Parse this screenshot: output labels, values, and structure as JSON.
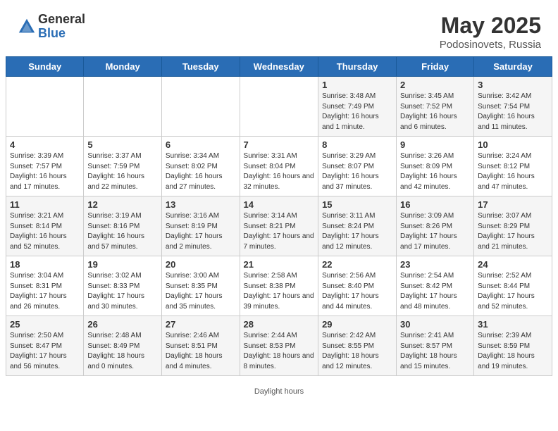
{
  "header": {
    "logo_general": "General",
    "logo_blue": "Blue",
    "month_year": "May 2025",
    "location": "Podosinovets, Russia"
  },
  "weekdays": [
    "Sunday",
    "Monday",
    "Tuesday",
    "Wednesday",
    "Thursday",
    "Friday",
    "Saturday"
  ],
  "weeks": [
    [
      {
        "day": "",
        "info": ""
      },
      {
        "day": "",
        "info": ""
      },
      {
        "day": "",
        "info": ""
      },
      {
        "day": "",
        "info": ""
      },
      {
        "day": "1",
        "info": "Sunrise: 3:48 AM\nSunset: 7:49 PM\nDaylight: 16 hours\nand 1 minute."
      },
      {
        "day": "2",
        "info": "Sunrise: 3:45 AM\nSunset: 7:52 PM\nDaylight: 16 hours\nand 6 minutes."
      },
      {
        "day": "3",
        "info": "Sunrise: 3:42 AM\nSunset: 7:54 PM\nDaylight: 16 hours\nand 11 minutes."
      }
    ],
    [
      {
        "day": "4",
        "info": "Sunrise: 3:39 AM\nSunset: 7:57 PM\nDaylight: 16 hours\nand 17 minutes."
      },
      {
        "day": "5",
        "info": "Sunrise: 3:37 AM\nSunset: 7:59 PM\nDaylight: 16 hours\nand 22 minutes."
      },
      {
        "day": "6",
        "info": "Sunrise: 3:34 AM\nSunset: 8:02 PM\nDaylight: 16 hours\nand 27 minutes."
      },
      {
        "day": "7",
        "info": "Sunrise: 3:31 AM\nSunset: 8:04 PM\nDaylight: 16 hours\nand 32 minutes."
      },
      {
        "day": "8",
        "info": "Sunrise: 3:29 AM\nSunset: 8:07 PM\nDaylight: 16 hours\nand 37 minutes."
      },
      {
        "day": "9",
        "info": "Sunrise: 3:26 AM\nSunset: 8:09 PM\nDaylight: 16 hours\nand 42 minutes."
      },
      {
        "day": "10",
        "info": "Sunrise: 3:24 AM\nSunset: 8:12 PM\nDaylight: 16 hours\nand 47 minutes."
      }
    ],
    [
      {
        "day": "11",
        "info": "Sunrise: 3:21 AM\nSunset: 8:14 PM\nDaylight: 16 hours\nand 52 minutes."
      },
      {
        "day": "12",
        "info": "Sunrise: 3:19 AM\nSunset: 8:16 PM\nDaylight: 16 hours\nand 57 minutes."
      },
      {
        "day": "13",
        "info": "Sunrise: 3:16 AM\nSunset: 8:19 PM\nDaylight: 17 hours\nand 2 minutes."
      },
      {
        "day": "14",
        "info": "Sunrise: 3:14 AM\nSunset: 8:21 PM\nDaylight: 17 hours\nand 7 minutes."
      },
      {
        "day": "15",
        "info": "Sunrise: 3:11 AM\nSunset: 8:24 PM\nDaylight: 17 hours\nand 12 minutes."
      },
      {
        "day": "16",
        "info": "Sunrise: 3:09 AM\nSunset: 8:26 PM\nDaylight: 17 hours\nand 17 minutes."
      },
      {
        "day": "17",
        "info": "Sunrise: 3:07 AM\nSunset: 8:29 PM\nDaylight: 17 hours\nand 21 minutes."
      }
    ],
    [
      {
        "day": "18",
        "info": "Sunrise: 3:04 AM\nSunset: 8:31 PM\nDaylight: 17 hours\nand 26 minutes."
      },
      {
        "day": "19",
        "info": "Sunrise: 3:02 AM\nSunset: 8:33 PM\nDaylight: 17 hours\nand 30 minutes."
      },
      {
        "day": "20",
        "info": "Sunrise: 3:00 AM\nSunset: 8:35 PM\nDaylight: 17 hours\nand 35 minutes."
      },
      {
        "day": "21",
        "info": "Sunrise: 2:58 AM\nSunset: 8:38 PM\nDaylight: 17 hours\nand 39 minutes."
      },
      {
        "day": "22",
        "info": "Sunrise: 2:56 AM\nSunset: 8:40 PM\nDaylight: 17 hours\nand 44 minutes."
      },
      {
        "day": "23",
        "info": "Sunrise: 2:54 AM\nSunset: 8:42 PM\nDaylight: 17 hours\nand 48 minutes."
      },
      {
        "day": "24",
        "info": "Sunrise: 2:52 AM\nSunset: 8:44 PM\nDaylight: 17 hours\nand 52 minutes."
      }
    ],
    [
      {
        "day": "25",
        "info": "Sunrise: 2:50 AM\nSunset: 8:47 PM\nDaylight: 17 hours\nand 56 minutes."
      },
      {
        "day": "26",
        "info": "Sunrise: 2:48 AM\nSunset: 8:49 PM\nDaylight: 18 hours\nand 0 minutes."
      },
      {
        "day": "27",
        "info": "Sunrise: 2:46 AM\nSunset: 8:51 PM\nDaylight: 18 hours\nand 4 minutes."
      },
      {
        "day": "28",
        "info": "Sunrise: 2:44 AM\nSunset: 8:53 PM\nDaylight: 18 hours\nand 8 minutes."
      },
      {
        "day": "29",
        "info": "Sunrise: 2:42 AM\nSunset: 8:55 PM\nDaylight: 18 hours\nand 12 minutes."
      },
      {
        "day": "30",
        "info": "Sunrise: 2:41 AM\nSunset: 8:57 PM\nDaylight: 18 hours\nand 15 minutes."
      },
      {
        "day": "31",
        "info": "Sunrise: 2:39 AM\nSunset: 8:59 PM\nDaylight: 18 hours\nand 19 minutes."
      }
    ]
  ],
  "footer": {
    "daylight_label": "Daylight hours"
  }
}
